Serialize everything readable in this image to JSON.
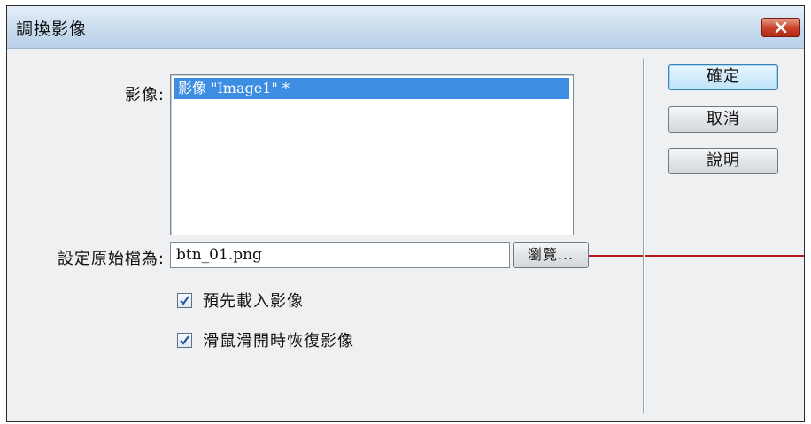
{
  "dialog": {
    "title": "調換影像",
    "close_icon": "close-x-icon"
  },
  "image_label": "影像:",
  "image_list": {
    "items": [
      {
        "label": "影像 \"Image1\" *",
        "selected": true
      }
    ]
  },
  "source_label": "設定原始檔為:",
  "source_field": {
    "value": "btn_01.png"
  },
  "browse_button": "瀏覽...",
  "options": [
    {
      "label": "預先載入影像",
      "checked": true
    },
    {
      "label": "滑鼠滑開時恢復影像",
      "checked": true
    }
  ],
  "buttons": {
    "ok": "確定",
    "cancel": "取消",
    "help": "說明"
  },
  "colors": {
    "selection": "#3d8ee3",
    "annotation_line": "#b51b1b",
    "close_button": "#c9452a"
  }
}
